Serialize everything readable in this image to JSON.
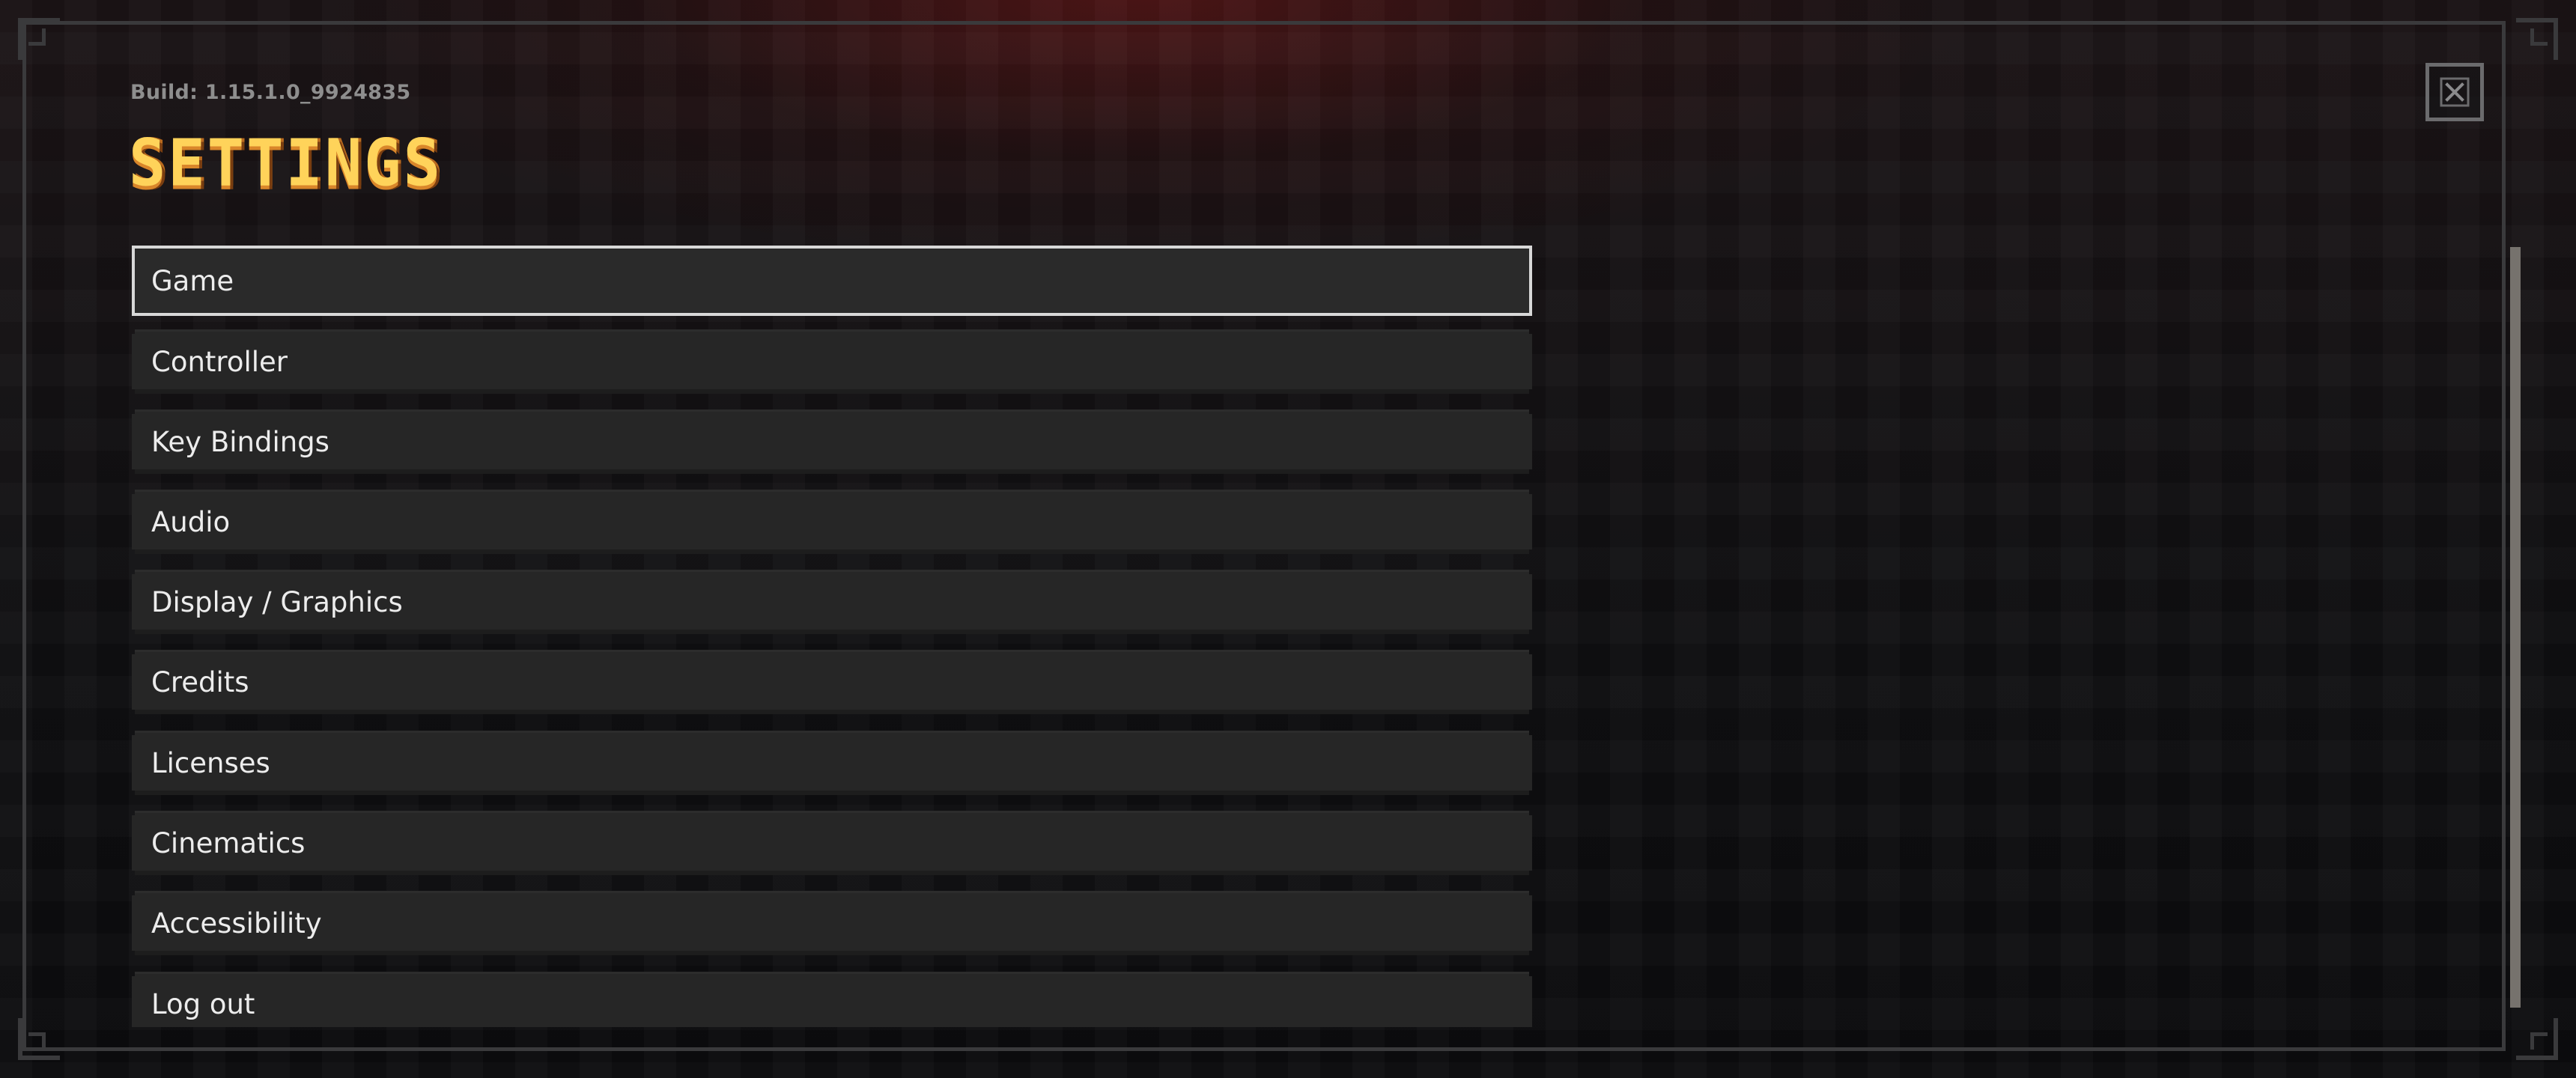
{
  "build_text": "Build: 1.15.1.0_9924835",
  "title": "SETTINGS",
  "close_icon": "close-x-icon",
  "menu": {
    "selected": "Game",
    "items": [
      {
        "label": "Game"
      },
      {
        "label": "Controller"
      },
      {
        "label": "Key Bindings"
      },
      {
        "label": "Audio"
      },
      {
        "label": "Display / Graphics"
      },
      {
        "label": "Credits"
      },
      {
        "label": "Licenses"
      },
      {
        "label": "Cinematics"
      },
      {
        "label": "Accessibility"
      },
      {
        "label": "Log out"
      }
    ]
  },
  "colors": {
    "title": "#ffd35a",
    "title_shadow": "#d9862a",
    "item_bg": "#262626",
    "item_text": "#ececec",
    "selected_border": "#d8d8d8",
    "frame": "#3a3a3c",
    "scrollbar_thumb": "#76726d"
  }
}
